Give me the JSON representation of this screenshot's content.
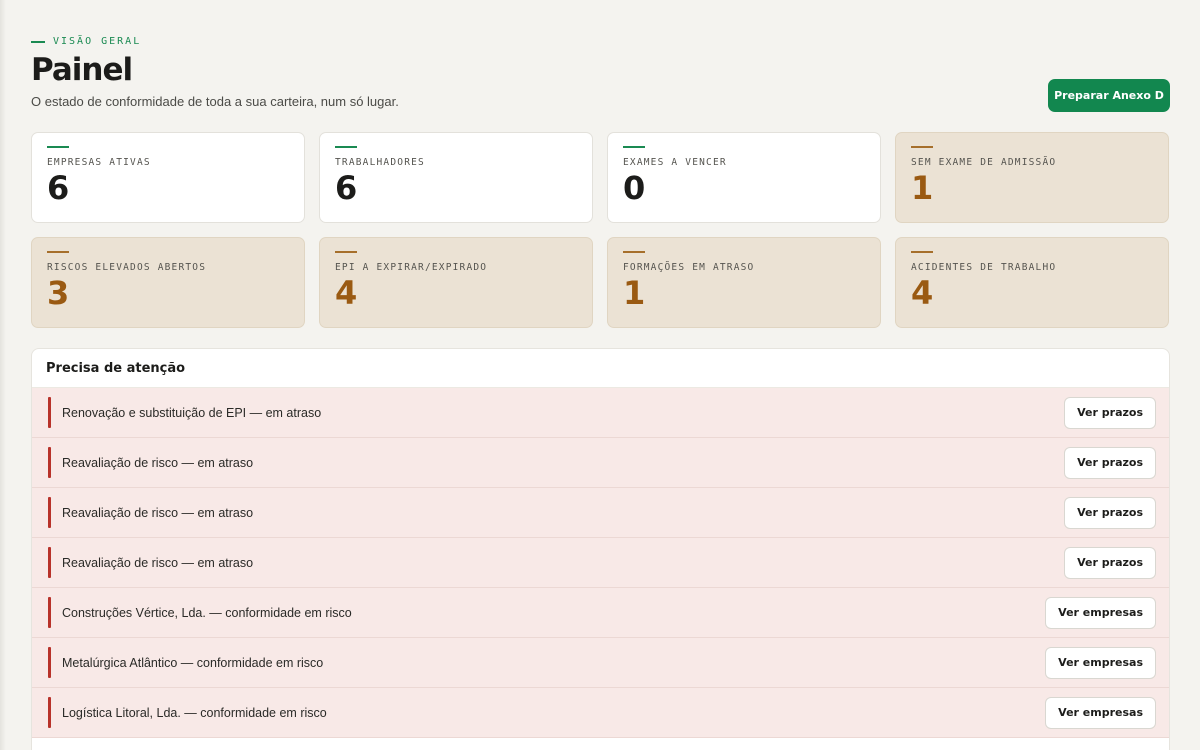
{
  "header": {
    "eyebrow": "VISÃO GERAL",
    "title": "Painel",
    "subtitle": "O estado de conformidade de toda a sua carteira, num só lugar.",
    "primary_action": "Preparar Anexo D"
  },
  "stats": [
    {
      "label": "EMPRESAS ATIVAS",
      "value": "6",
      "tone": "neutral"
    },
    {
      "label": "TRABALHADORES",
      "value": "6",
      "tone": "neutral"
    },
    {
      "label": "EXAMES A VENCER",
      "value": "0",
      "tone": "neutral"
    },
    {
      "label": "SEM EXAME DE ADMISSÃO",
      "value": "1",
      "tone": "warn"
    },
    {
      "label": "RISCOS ELEVADOS ABERTOS",
      "value": "3",
      "tone": "warn"
    },
    {
      "label": "EPI A EXPIRAR/EXPIRADO",
      "value": "4",
      "tone": "warn"
    },
    {
      "label": "FORMAÇÕES EM ATRASO",
      "value": "1",
      "tone": "warn"
    },
    {
      "label": "ACIDENTES DE TRABALHO",
      "value": "4",
      "tone": "warn"
    }
  ],
  "attention": {
    "title": "Precisa de atenção",
    "items": [
      {
        "text": "Renovação e substituição de EPI — em atraso",
        "action": "Ver prazos"
      },
      {
        "text": "Reavaliação de risco — em atraso",
        "action": "Ver prazos"
      },
      {
        "text": "Reavaliação de risco — em atraso",
        "action": "Ver prazos"
      },
      {
        "text": "Reavaliação de risco — em atraso",
        "action": "Ver prazos"
      },
      {
        "text": "Construções Vértice, Lda. — conformidade em risco",
        "action": "Ver empresas"
      },
      {
        "text": "Metalúrgica Atlântico — conformidade em risco",
        "action": "Ver empresas"
      },
      {
        "text": "Logística Litoral, Lda. — conformidade em risco",
        "action": "Ver empresas"
      }
    ]
  },
  "colors": {
    "accent_green": "#12874f",
    "warn_bg": "#ebe2d4",
    "warn_value": "#9a5a12",
    "alert_bar": "#b8322a",
    "alert_row_bg": "#f8e9e7"
  }
}
